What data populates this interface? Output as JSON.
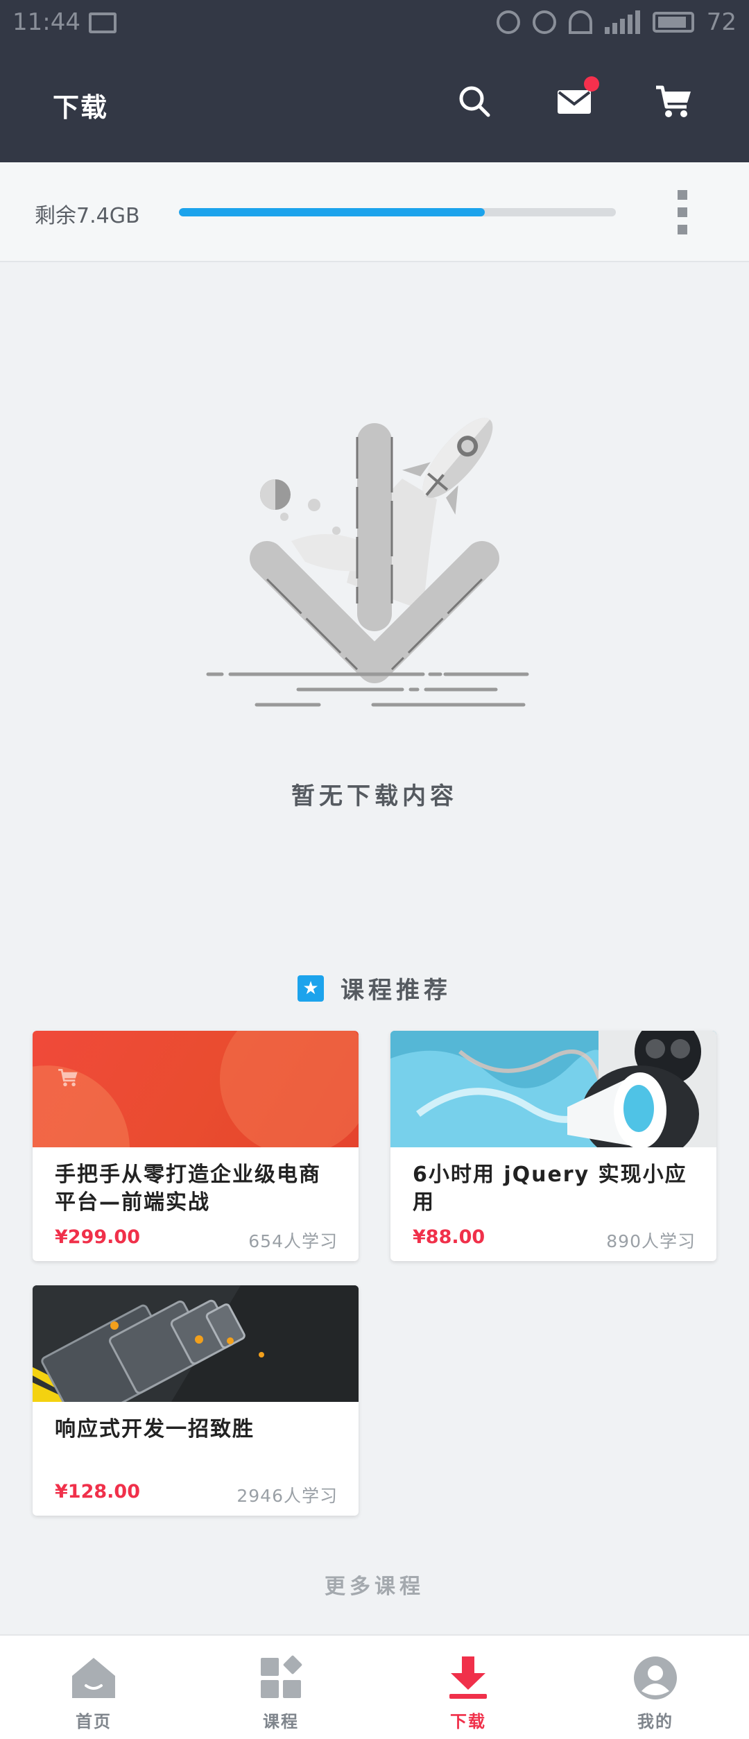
{
  "status_bar": {
    "time": "11:44",
    "battery": "72"
  },
  "header": {
    "title": "下载",
    "icons": [
      "search-icon",
      "mail-icon",
      "cart-icon"
    ],
    "mail_has_badge": true
  },
  "storage": {
    "remaining_label": "剩余7.4GB",
    "used_fraction": 0.7,
    "more_icon": "more-vertical-icon"
  },
  "empty_state": {
    "illustration": "download-arrow-rocket",
    "message": "暂无下载内容"
  },
  "recommend": {
    "title": "课程推荐",
    "icon": "star-icon",
    "courses": [
      {
        "title": "手把手从零打造企业级电商平台—前端实战",
        "price": "¥299.00",
        "learners": "654人学习",
        "thumb": "red-cart-banner"
      },
      {
        "title": "6小时用 jQuery 实现小应用",
        "price": "¥88.00",
        "learners": "890人学习",
        "thumb": "megaphone-banner"
      },
      {
        "title": "响应式开发一招致胜",
        "price": "¥128.00",
        "learners": "2946人学习",
        "thumb": "devices-banner"
      }
    ],
    "more_label": "更多课程"
  },
  "tabbar": {
    "active_index": 2,
    "tabs": [
      {
        "label": "首页",
        "icon": "home-icon"
      },
      {
        "label": "课程",
        "icon": "courses-icon"
      },
      {
        "label": "下载",
        "icon": "download-icon"
      },
      {
        "label": "我的",
        "icon": "profile-icon"
      }
    ]
  },
  "colors": {
    "header_bg": "#333845",
    "accent_blue": "#1ca3ec",
    "price_red": "#f0304a",
    "page_bg": "#f0f2f4"
  }
}
